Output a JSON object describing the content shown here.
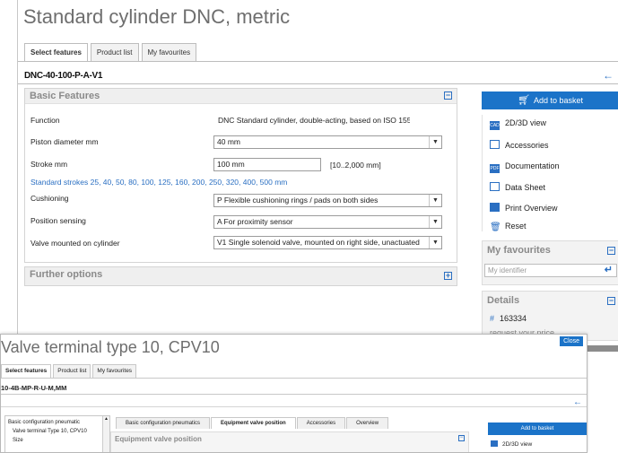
{
  "main": {
    "title": "Standard cylinder DNC, metric",
    "tabs": [
      "Select features",
      "Product list",
      "My favourites"
    ],
    "part_code": "DNC-40-100-P-A-V1",
    "basic_features": {
      "title": "Basic Features",
      "function_label": "Function",
      "function_value": "DNC Standard cylinder, double-acting, based on ISO 15552",
      "piston_label": "Piston diameter mm",
      "piston_value": "40 mm",
      "stroke_label": "Stroke mm",
      "stroke_value": "100 mm",
      "stroke_range": "[10..2,000 mm]",
      "standard_strokes": "Standard strokes 25, 40, 50, 80, 100, 125, 160, 200, 250, 320, 400, 500 mm",
      "cushioning_label": "Cushioning",
      "cushioning_value": "P Flexible cushioning rings / pads on both sides",
      "position_label": "Position sensing",
      "position_value": "A For proximity sensor",
      "valve_label": "Valve mounted on cylinder",
      "valve_value": "V1 Single solenoid valve, mounted on right side, unactuated"
    },
    "further_options": "Further options"
  },
  "sidebar": {
    "add_to_basket": "Add to basket",
    "actions": [
      "2D/3D view",
      "Accessories",
      "Documentation",
      "Data Sheet",
      "Print Overview",
      "Reset"
    ],
    "favourites_title": "My favourites",
    "favourites_placeholder": "My identifier",
    "details_title": "Details",
    "part_number": "163334",
    "price_link": "request your price"
  },
  "second_window": {
    "title": "Valve terminal type 10, CPV10",
    "close": "Close",
    "tabs": [
      "Select features",
      "Product list",
      "My favourites"
    ],
    "part_code": "10-4B-MP-R-U-M,MM",
    "tree_items": [
      "Basic configuration pneumatic",
      "Valve terminal Type 10, CPV10",
      "Size"
    ],
    "sub_tabs": [
      "Basic configuration pneumatics",
      "Equipment valve position",
      "Accessories",
      "Overview"
    ],
    "panel_title": "Equipment valve position",
    "add_to_basket": "Add to basket",
    "view_label": "2D/3D view"
  },
  "colors": {
    "accent": "#1b73c8",
    "link": "#2a6fc2",
    "title_grey": "#6e6e6e"
  }
}
